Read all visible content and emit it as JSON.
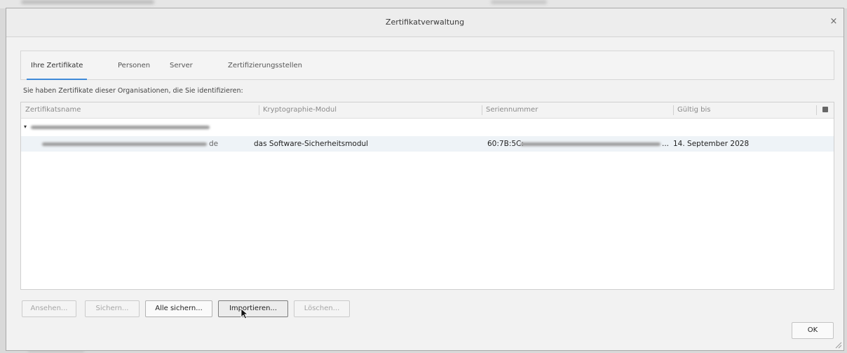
{
  "dialog": {
    "title": "Zertifikatverwaltung",
    "close_symbol": "×"
  },
  "tabs": [
    {
      "label": "Ihre Zertifikate",
      "active": true
    },
    {
      "label": "Personen",
      "active": false
    },
    {
      "label": "Server",
      "active": false
    },
    {
      "label": "Zertifizierungsstellen",
      "active": false
    }
  ],
  "intro_text": "Sie haben Zertifikate dieser Organisationen, die Sie identifizieren:",
  "table": {
    "columns": [
      "Zertifikatsname",
      "Kryptographie-Modul",
      "Seriennummer",
      "Gültig bis"
    ],
    "rows": [
      {
        "name_suffix": "de",
        "module": "das Software-Sicherheitsmodul",
        "serial_prefix": "60:7B:5C:",
        "serial_suffix": "...",
        "valid_until": "14. September 2028"
      }
    ]
  },
  "buttons": {
    "view": "Ansehen...",
    "backup": "Sichern...",
    "backup_all": "Alle sichern...",
    "import": "Importieren...",
    "delete": "Löschen...",
    "ok": "OK"
  },
  "colors": {
    "accent": "#3f8ad8",
    "selected_row": "#eef3f7"
  }
}
